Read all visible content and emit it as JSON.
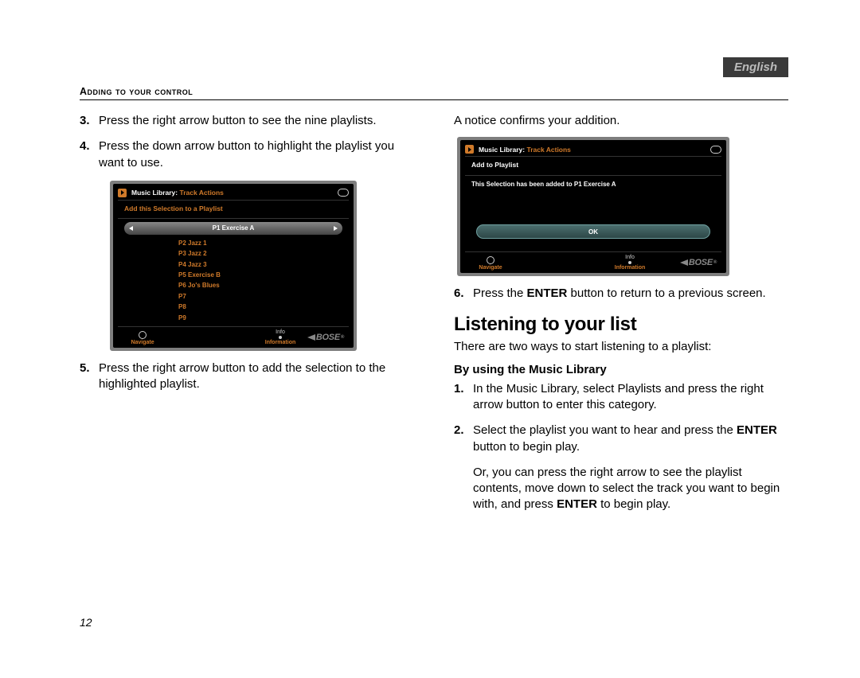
{
  "language_tab": "English",
  "header": "Adding to your control",
  "page_number": "12",
  "left": {
    "step3": {
      "num": "3.",
      "text": "Press the right arrow button to see the nine playlists."
    },
    "step4": {
      "num": "4.",
      "text": "Press the down arrow button to highlight the playlist you want to use."
    },
    "step5": {
      "num": "5.",
      "text": "Press the right arrow button to add the selection to the highlighted playlist."
    }
  },
  "right": {
    "notice_line": "A notice confirms your addition.",
    "step6": {
      "num": "6.",
      "pre": "Press the ",
      "bold": "ENTER",
      "post": " button to return to a previous screen."
    },
    "h2": "Listening to your list",
    "intro": "There are two ways to start listening to a playlist:",
    "sub_h": "By using the Music Library",
    "li1": {
      "num": "1.",
      "text": "In the Music Library, select Playlists and press the right arrow button to enter this category."
    },
    "li2": {
      "num": "2.",
      "pre": "Select the playlist you want to hear and press the ",
      "bold": "ENTER",
      "post": " button to begin play."
    },
    "or_para_pre": "Or, you can press the right arrow to see the playlist contents, move down to select the track you want to begin with, and press ",
    "or_para_bold": "ENTER",
    "or_para_post": " to begin play."
  },
  "screen_a": {
    "title_white": "Music Library:",
    "title_orange": "Track Actions",
    "subhead": "Add this Selection to a Playlist",
    "selected": "P1 Exercise A",
    "items": [
      "P2 Jazz 1",
      "P3 Jazz 2",
      "P4 Jazz 3",
      "P5 Exercise B",
      "P6 Jo's Blues",
      "P7",
      "P8",
      "P9"
    ],
    "foot_info_top": "Info",
    "foot_navigate": "Navigate",
    "foot_information": "Information",
    "logo": "BOSE"
  },
  "screen_b": {
    "title_white": "Music Library:",
    "title_orange": "Track Actions",
    "subhead": "Add to Playlist",
    "confirm": "This Selection has been added to P1 Exercise A",
    "ok": "OK",
    "foot_info_top": "Info",
    "foot_navigate": "Navigate",
    "foot_information": "Information",
    "logo": "BOSE"
  }
}
